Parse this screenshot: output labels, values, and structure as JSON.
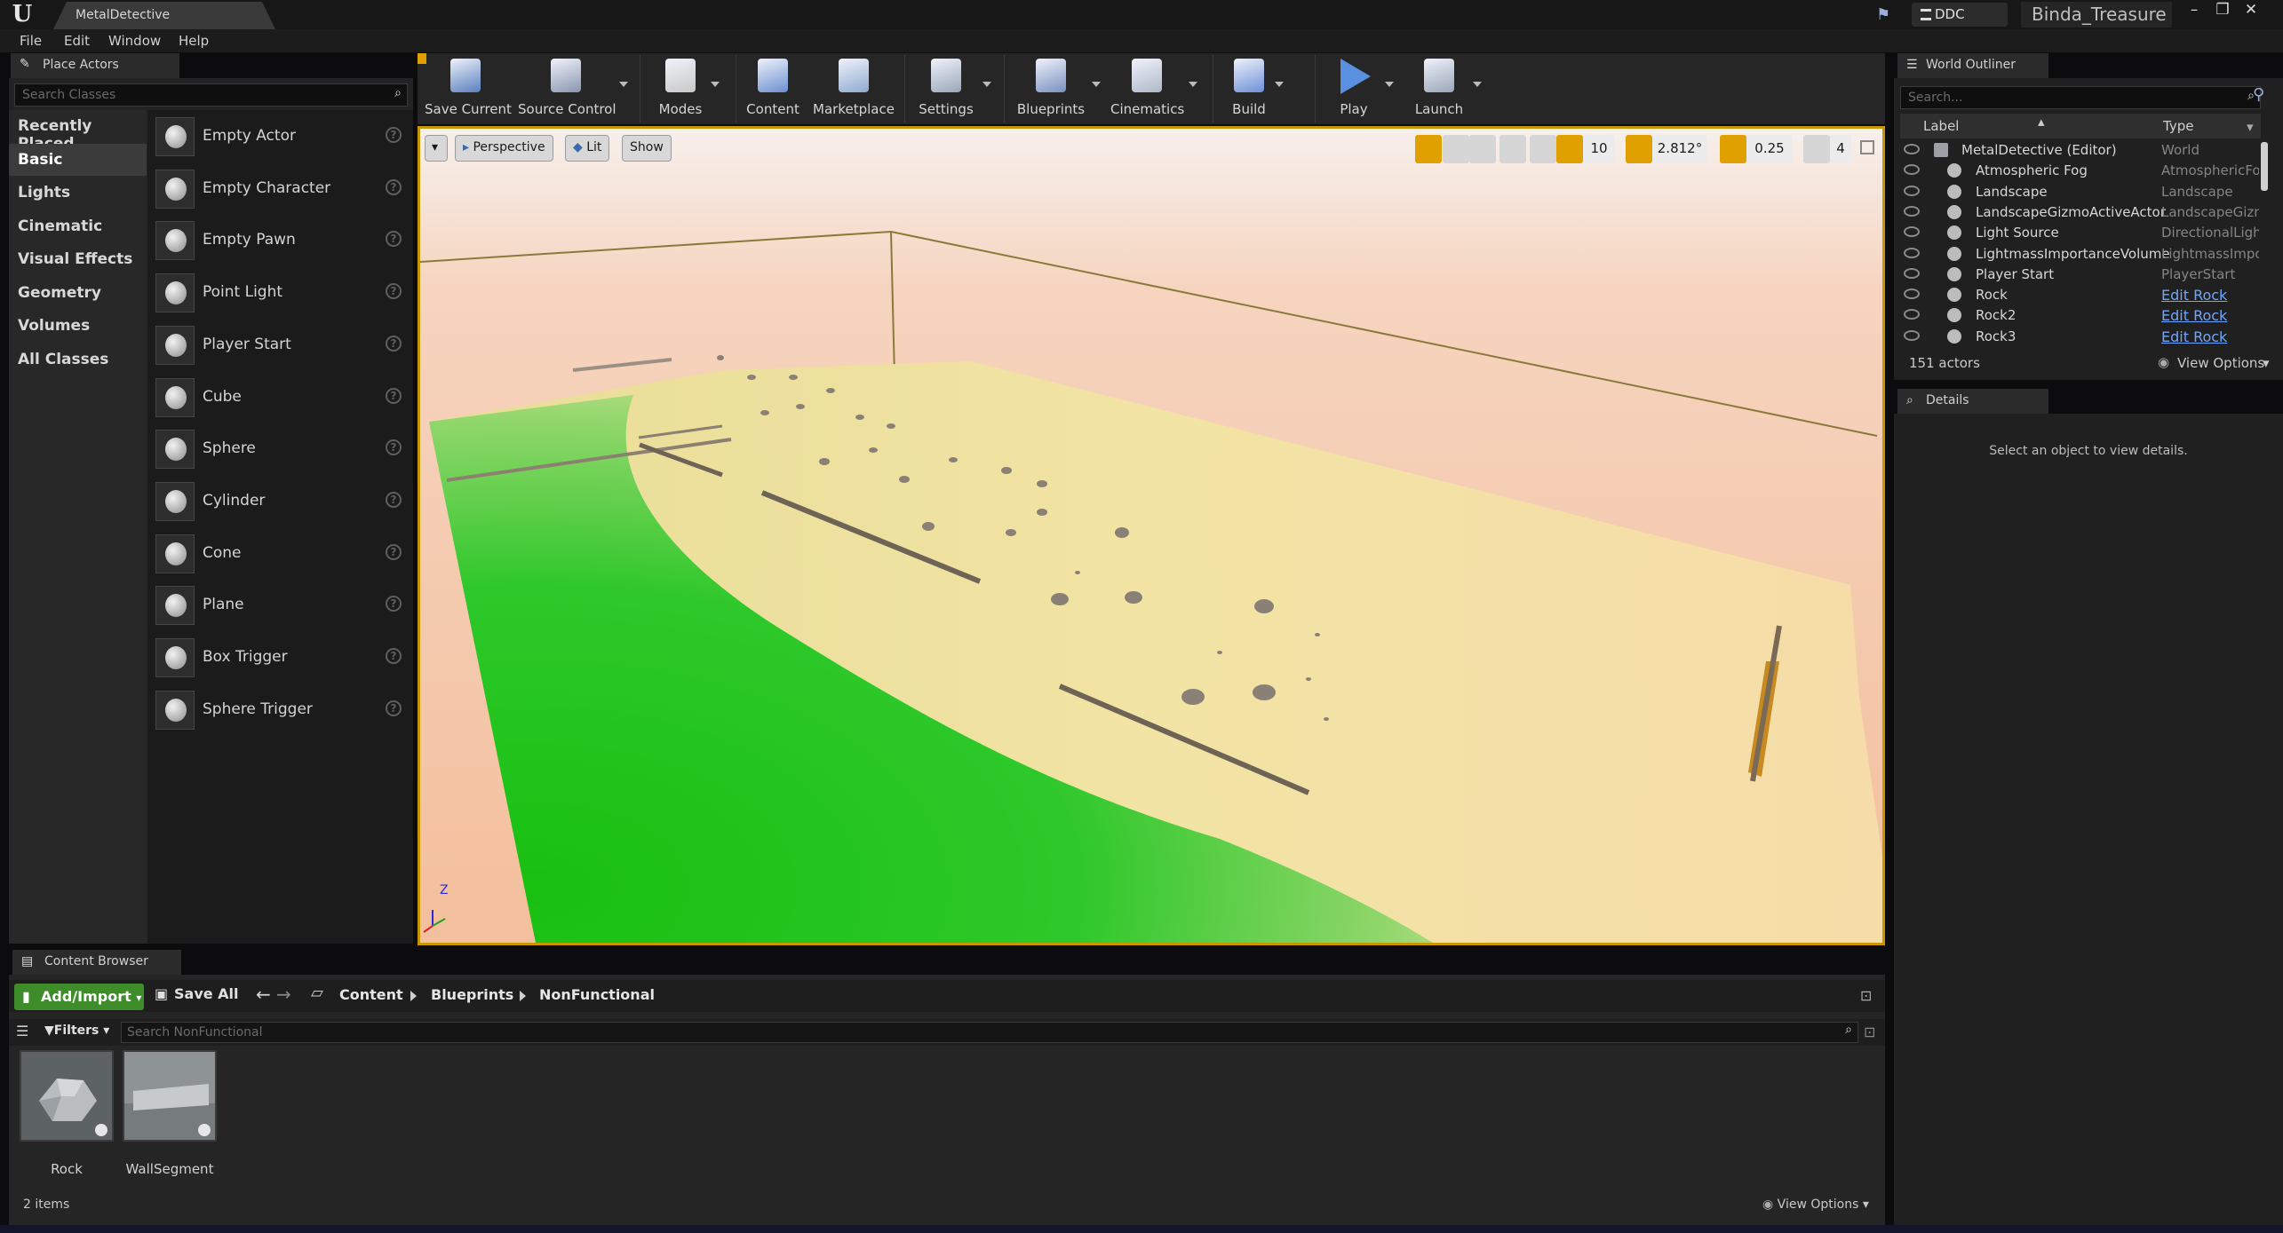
{
  "window": {
    "tab_title": "MetalDetective",
    "ddc_label": "DDC",
    "project_name": "Binda_Treasure"
  },
  "menu": [
    "File",
    "Edit",
    "Window",
    "Help"
  ],
  "place_actors": {
    "tab_label": "Place Actors",
    "search_placeholder": "Search Classes",
    "categories": [
      {
        "label": "Recently Placed"
      },
      {
        "label": "Basic"
      },
      {
        "label": "Lights"
      },
      {
        "label": "Cinematic"
      },
      {
        "label": "Visual Effects"
      },
      {
        "label": "Geometry"
      },
      {
        "label": "Volumes"
      },
      {
        "label": "All Classes"
      }
    ],
    "selected_category": "Basic",
    "actors": [
      {
        "label": "Empty Actor",
        "icon": "empty-actor-icon"
      },
      {
        "label": "Empty Character",
        "icon": "character-icon"
      },
      {
        "label": "Empty Pawn",
        "icon": "pawn-icon"
      },
      {
        "label": "Point Light",
        "icon": "point-light-icon"
      },
      {
        "label": "Player Start",
        "icon": "player-start-icon"
      },
      {
        "label": "Cube",
        "icon": "cube-icon"
      },
      {
        "label": "Sphere",
        "icon": "sphere-icon"
      },
      {
        "label": "Cylinder",
        "icon": "cylinder-icon"
      },
      {
        "label": "Cone",
        "icon": "cone-icon"
      },
      {
        "label": "Plane",
        "icon": "plane-icon"
      },
      {
        "label": "Box Trigger",
        "icon": "box-trigger-icon"
      },
      {
        "label": "Sphere Trigger",
        "icon": "sphere-trigger-icon"
      }
    ]
  },
  "toolbar": {
    "buttons": [
      {
        "label": "Save Current",
        "icon": "save-icon"
      },
      {
        "label": "Source Control",
        "icon": "source-control-icon"
      },
      {
        "label": "Modes",
        "icon": "modes-icon"
      },
      {
        "label": "Content",
        "icon": "content-icon"
      },
      {
        "label": "Marketplace",
        "icon": "marketplace-icon"
      },
      {
        "label": "Settings",
        "icon": "settings-icon"
      },
      {
        "label": "Blueprints",
        "icon": "blueprints-icon"
      },
      {
        "label": "Cinematics",
        "icon": "cinematics-icon"
      },
      {
        "label": "Build",
        "icon": "build-icon"
      },
      {
        "label": "Play",
        "icon": "play-icon"
      },
      {
        "label": "Launch",
        "icon": "launch-icon"
      }
    ]
  },
  "viewport": {
    "view_mode": "Perspective",
    "lighting": "Lit",
    "show": "Show",
    "grid_snap": "10",
    "rotation_snap": "2.812°",
    "scale_snap": "0.25",
    "camera_speed": "4",
    "axis_z": "Z",
    "colors": {
      "sky": "#f3c3a4",
      "sand": "#f0e1a0",
      "grass": "#22b81c",
      "accent": "#e0a100"
    }
  },
  "world_outliner": {
    "tab_label": "World Outliner",
    "search_placeholder": "Search...",
    "col_label": "Label",
    "col_type": "Type",
    "rows": [
      {
        "name": "MetalDetective (Editor)",
        "type": "World",
        "link": false
      },
      {
        "name": "Atmospheric Fog",
        "type": "AtmosphericFog",
        "link": false
      },
      {
        "name": "Landscape",
        "type": "Landscape",
        "link": false
      },
      {
        "name": "LandscapeGizmoActiveActor",
        "type": "LandscapeGizm",
        "link": false
      },
      {
        "name": "Light Source",
        "type": "DirectionalLight",
        "link": false
      },
      {
        "name": "LightmassImportanceVolume",
        "type": "LightmassImpo",
        "link": false
      },
      {
        "name": "Player Start",
        "type": "PlayerStart",
        "link": false
      },
      {
        "name": "Rock",
        "type": "Edit Rock",
        "link": true
      },
      {
        "name": "Rock2",
        "type": "Edit Rock",
        "link": true
      },
      {
        "name": "Rock3",
        "type": "Edit Rock",
        "link": true
      }
    ],
    "actor_count": "151 actors",
    "view_options": "View Options"
  },
  "details": {
    "tab_label": "Details",
    "empty_message": "Select an object to view details."
  },
  "content_browser": {
    "tab_label": "Content Browser",
    "add_import": "Add/Import",
    "save_all": "Save All",
    "breadcrumbs": [
      "Content",
      "Blueprints",
      "NonFunctional"
    ],
    "filters": "Filters",
    "search_placeholder": "Search NonFunctional",
    "assets": [
      {
        "label": "Rock",
        "icon": "rock-asset-icon"
      },
      {
        "label": "WallSegment",
        "icon": "wall-segment-asset-icon"
      }
    ],
    "item_count": "2 items",
    "view_options": "View Options"
  }
}
